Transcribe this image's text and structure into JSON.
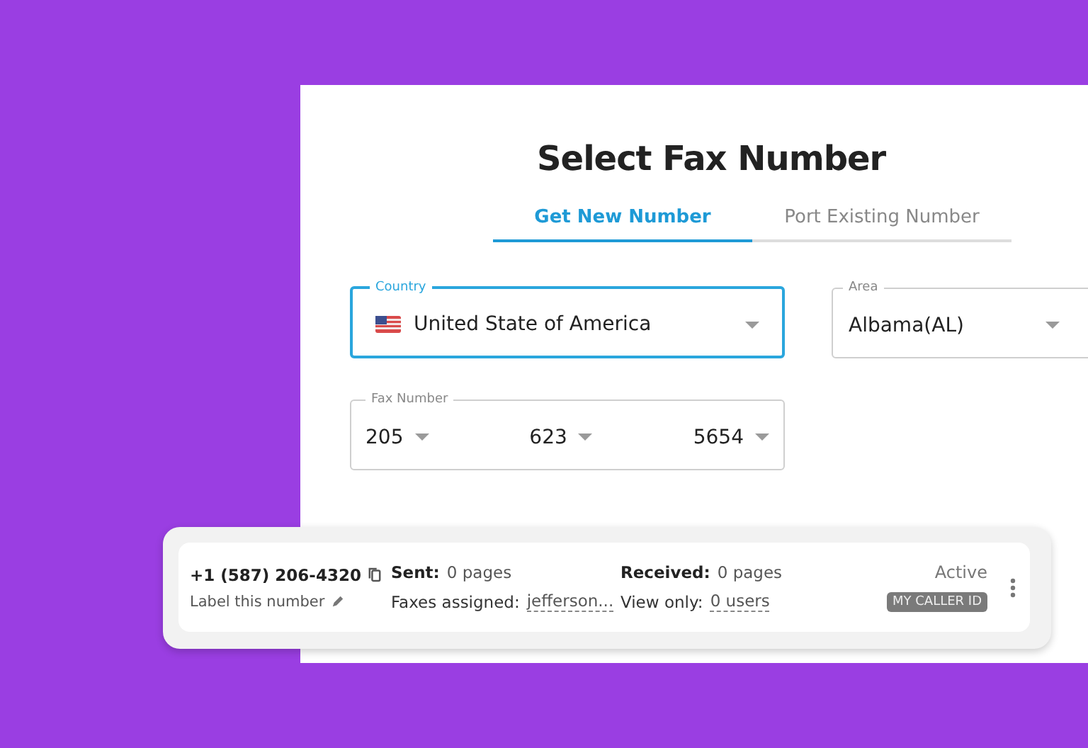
{
  "title": "Select Fax Number",
  "tabs": [
    {
      "label": "Get New Number",
      "selected": true
    },
    {
      "label": "Port Existing Number",
      "selected": false
    }
  ],
  "country": {
    "label": "Country",
    "value": "United State of America",
    "focused": true
  },
  "area": {
    "label": "Area",
    "value": "Albama(AL)",
    "focused": false
  },
  "fax_number": {
    "label": "Fax Number",
    "parts": [
      "205",
      "623",
      "5654"
    ]
  },
  "number_card": {
    "number": "+1 (587) 206-4320",
    "label_link": "Label this number",
    "sent_label": "Sent:",
    "sent_value": "0 pages",
    "faxes_assigned_label": "Faxes assigned:",
    "faxes_assigned_value": "jefferson...",
    "received_label": "Received:",
    "received_value": "0 pages",
    "view_only_label": "View only:",
    "view_only_value": "0 users",
    "status": "Active",
    "badge": "MY CALLER ID"
  }
}
